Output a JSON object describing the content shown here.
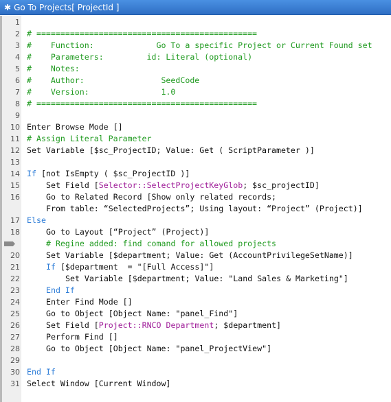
{
  "window": {
    "title": "Go To Projects[ ProjectId ]",
    "title_icon": "asterisk-icon"
  },
  "colors": {
    "comment": "#1f9a1f",
    "keyword": "#2f7ed8",
    "field": "#a0209a",
    "text": "#111111"
  },
  "lines": [
    {
      "num": "1",
      "indent": 0,
      "segs": []
    },
    {
      "num": "2",
      "indent": 0,
      "segs": [
        {
          "t": "# ==============================================",
          "k": "comment"
        }
      ]
    },
    {
      "num": "3",
      "indent": 0,
      "segs": [
        {
          "t": "#    Function:             Go To a specific Project or Current Found set",
          "k": "comment"
        }
      ]
    },
    {
      "num": "4",
      "indent": 0,
      "segs": [
        {
          "t": "#    Parameters:         id: Literal (optional)",
          "k": "comment"
        }
      ]
    },
    {
      "num": "5",
      "indent": 0,
      "segs": [
        {
          "t": "#    Notes:",
          "k": "comment"
        }
      ]
    },
    {
      "num": "6",
      "indent": 0,
      "segs": [
        {
          "t": "#    Author:                SeedCode",
          "k": "comment"
        }
      ]
    },
    {
      "num": "7",
      "indent": 0,
      "segs": [
        {
          "t": "#    Version:               1.0",
          "k": "comment"
        }
      ]
    },
    {
      "num": "8",
      "indent": 0,
      "segs": [
        {
          "t": "# ==============================================",
          "k": "comment"
        }
      ]
    },
    {
      "num": "9",
      "indent": 0,
      "segs": []
    },
    {
      "num": "10",
      "indent": 0,
      "segs": [
        {
          "t": "Enter Browse Mode []",
          "k": "text"
        }
      ]
    },
    {
      "num": "11",
      "indent": 0,
      "segs": [
        {
          "t": "# Assign Literal Parameter",
          "k": "comment"
        }
      ]
    },
    {
      "num": "12",
      "indent": 0,
      "segs": [
        {
          "t": "Set Variable [$sc_ProjectID; Value: Get ( ScriptParameter )]",
          "k": "text"
        }
      ]
    },
    {
      "num": "13",
      "indent": 0,
      "segs": []
    },
    {
      "num": "14",
      "indent": 0,
      "segs": [
        {
          "t": "If",
          "k": "keyword"
        },
        {
          "t": " [not IsEmpty ( $sc_ProjectID )]",
          "k": "text"
        }
      ]
    },
    {
      "num": "15",
      "indent": 1,
      "segs": [
        {
          "t": "Set Field [",
          "k": "text"
        },
        {
          "t": "Selector::SelectProjectKeyGlob",
          "k": "field"
        },
        {
          "t": "; $sc_projectID]",
          "k": "text"
        }
      ]
    },
    {
      "num": "16",
      "indent": 1,
      "segs": [
        {
          "t": "Go to Related Record [Show only related records;",
          "k": "text"
        }
      ]
    },
    {
      "num": "",
      "indent": 1,
      "segs": [
        {
          "t": "From table: “SelectedProjects”; Using layout: “Project” (Project)]",
          "k": "text"
        }
      ]
    },
    {
      "num": "17",
      "indent": 0,
      "segs": [
        {
          "t": "Else",
          "k": "keyword"
        }
      ]
    },
    {
      "num": "18",
      "indent": 1,
      "segs": [
        {
          "t": "Go to Layout [“Project” (Project)]",
          "k": "text"
        }
      ]
    },
    {
      "num": "19",
      "breakpoint": true,
      "indent": 1,
      "segs": [
        {
          "t": "# Regine added: find comand for allowed projects",
          "k": "comment"
        }
      ]
    },
    {
      "num": "20",
      "indent": 1,
      "segs": [
        {
          "t": "Set Variable [$department; Value: Get (AccountPrivilegeSetName)]",
          "k": "text"
        }
      ]
    },
    {
      "num": "21",
      "indent": 1,
      "segs": [
        {
          "t": "If",
          "k": "keyword"
        },
        {
          "t": " [$department  = \"[Full Access]\"]",
          "k": "text"
        }
      ]
    },
    {
      "num": "22",
      "indent": 2,
      "segs": [
        {
          "t": "Set Variable [$department; Value: \"Land Sales & Marketing\"]",
          "k": "text"
        }
      ]
    },
    {
      "num": "23",
      "indent": 1,
      "segs": [
        {
          "t": "End If",
          "k": "keyword"
        }
      ]
    },
    {
      "num": "24",
      "indent": 1,
      "segs": [
        {
          "t": "Enter Find Mode []",
          "k": "text"
        }
      ]
    },
    {
      "num": "25",
      "indent": 1,
      "segs": [
        {
          "t": "Go to Object [Object Name: \"panel_Find\"]",
          "k": "text"
        }
      ]
    },
    {
      "num": "26",
      "indent": 1,
      "segs": [
        {
          "t": "Set Field [",
          "k": "text"
        },
        {
          "t": "Project::RNCO Department",
          "k": "field"
        },
        {
          "t": "; $department]",
          "k": "text"
        }
      ]
    },
    {
      "num": "27",
      "indent": 1,
      "segs": [
        {
          "t": "Perform Find []",
          "k": "text"
        }
      ]
    },
    {
      "num": "28",
      "indent": 1,
      "segs": [
        {
          "t": "Go to Object [Object Name: \"panel_ProjectView\"]",
          "k": "text"
        }
      ]
    },
    {
      "num": "29",
      "indent": 0,
      "segs": []
    },
    {
      "num": "30",
      "indent": 0,
      "segs": [
        {
          "t": "End If",
          "k": "keyword"
        }
      ]
    },
    {
      "num": "31",
      "indent": 0,
      "segs": [
        {
          "t": "Select Window [Current Window]",
          "k": "text"
        }
      ]
    }
  ]
}
